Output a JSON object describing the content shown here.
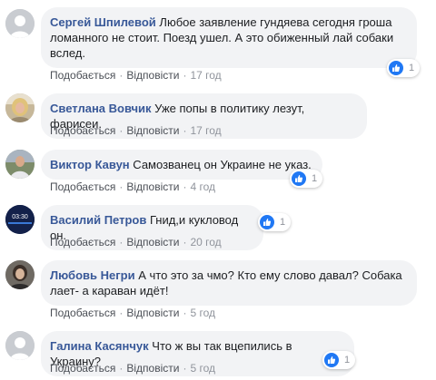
{
  "comments": [
    {
      "author": "Сергей Шпилевой",
      "text": "Любое заявление гундяева сегодня гроша ломанного не стоит. Поезд ушел. А это обиженный лай собаки вслед.",
      "like_label": "Подобається",
      "reply_label": "Відповісти",
      "time": "17 год",
      "reactions": "1"
    },
    {
      "author": "Светлана Вовчик",
      "text": "Уже попы в политику лезут, фарисеи.",
      "like_label": "Подобається",
      "reply_label": "Відповісти",
      "time": "17 год"
    },
    {
      "author": "Виктор Кавун",
      "text": "Самозванец он Украине не указ.",
      "like_label": "Подобається",
      "reply_label": "Відповісти",
      "time": "4 год",
      "reactions": "1"
    },
    {
      "author": "Василий Петров",
      "text": "Гнид,и кукловод он.",
      "like_label": "Подобається",
      "reply_label": "Відповісти",
      "time": "20 год",
      "reactions": "1"
    },
    {
      "author": "Любовь Негри",
      "text": "А что это за чмо? Кто ему слово давал? Собака лает- а караван идёт!",
      "like_label": "Подобається",
      "reply_label": "Відповісти",
      "time": "5 год"
    },
    {
      "author": "Галина Касянчук",
      "text": "Что ж вы так вцепились в Украину?",
      "like_label": "Подобається",
      "reply_label": "Відповісти",
      "time": "5 год",
      "reactions": "1"
    }
  ],
  "avatar_icons": [
    "avatar-default-icon",
    "avatar-photo-blonde-woman",
    "avatar-photo-man",
    "avatar-photo-time-screen",
    "avatar-photo-woman",
    "avatar-default-icon"
  ],
  "avatar_screen_text": "03:30",
  "colors": {
    "author": "#385898",
    "bubble": "#f2f3f5",
    "like_blue": "#2078f4",
    "meta": "#90949c"
  }
}
